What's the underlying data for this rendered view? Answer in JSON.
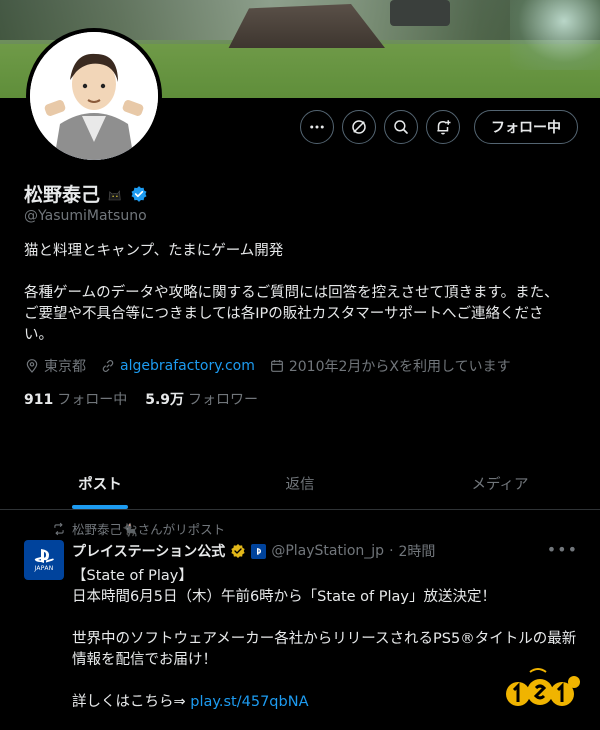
{
  "profile": {
    "display_name": "松野泰己",
    "handle": "@YasumiMatsuno",
    "bio_line1": "猫と料理とキャンプ、たまにゲーム開発",
    "bio_line2": "各種ゲームのデータや攻略に関するご質問には回答を控えさせて頂きます。また、ご要望や不具合等につきましては各IPの販社カスタマーサポートへご連絡ください。",
    "location": "東京都",
    "website": "algebrafactory.com",
    "joined": "2010年2月からXを利用しています",
    "following_count": "911",
    "following_label": "フォロー中",
    "followers_count": "5.9万",
    "followers_label": "フォロワー"
  },
  "actions": {
    "follow_label": "フォロー中",
    "more_icon": "more-icon",
    "grok_icon": "grok-icon",
    "search_icon": "search-icon",
    "notify_icon": "bell-plus-icon"
  },
  "tabs": [
    {
      "label": "ポスト",
      "active": true
    },
    {
      "label": "返信",
      "active": false
    },
    {
      "label": "メディア",
      "active": false
    }
  ],
  "post": {
    "repost_text": "松野泰己🐈‍⬛さんがリポスト",
    "author_name": "プレイステーション公式",
    "author_handle": "@PlayStation_jp",
    "time": "2時間",
    "avatar_label": "JAPAN",
    "body": {
      "line1": "【State of Play】",
      "line2": "日本時間6月5日（木）午前6時から「State of Play」放送決定！",
      "line3": "世界中のソフトウェアメーカー各社からリリースされるPS5®タイトルの最新",
      "line4": "情報を配信でお届け！",
      "line5_prefix": "詳しくはこちら⇒ ",
      "line5_link": "play.st/457qbNA"
    }
  },
  "colors": {
    "background": "#000000",
    "text": "#e7e9ea",
    "muted": "#71767b",
    "accent": "#1d9bf0",
    "border": "#2f3336"
  }
}
